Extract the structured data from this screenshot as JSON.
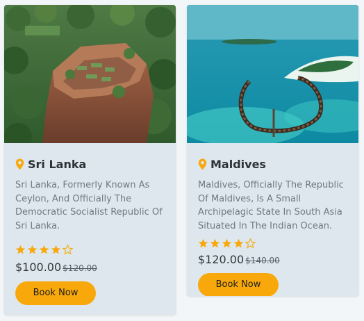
{
  "cards": [
    {
      "image_alt": "Sri Lanka aerial view",
      "title": "Sri Lanka",
      "description": "Sri Lanka, Formerly Known As Ceylon, And Officially The Democratic Socialist Republic Of Sri Lanka.",
      "rating": 4,
      "rating_max": 5,
      "price": "$100.00",
      "old_price": "$120.00",
      "button_label": "Book Now"
    },
    {
      "image_alt": "Maldives resort aerial view",
      "title": "Maldives",
      "description": "Maldives, Officially The Republic Of Maldives, Is A Small Archipelagic State In South Asia Situated In The Indian Ocean.",
      "rating": 4,
      "rating_max": 5,
      "price": "$120.00",
      "old_price": "$140.00",
      "button_label": "Book Now"
    }
  ],
  "colors": {
    "accent": "#f8a80a",
    "card_bg": "#dde7ed",
    "star": "#f8a80a"
  },
  "icons": {
    "location": "location-pin-icon",
    "star_filled": "star-filled-icon",
    "star_empty": "star-outline-icon"
  }
}
